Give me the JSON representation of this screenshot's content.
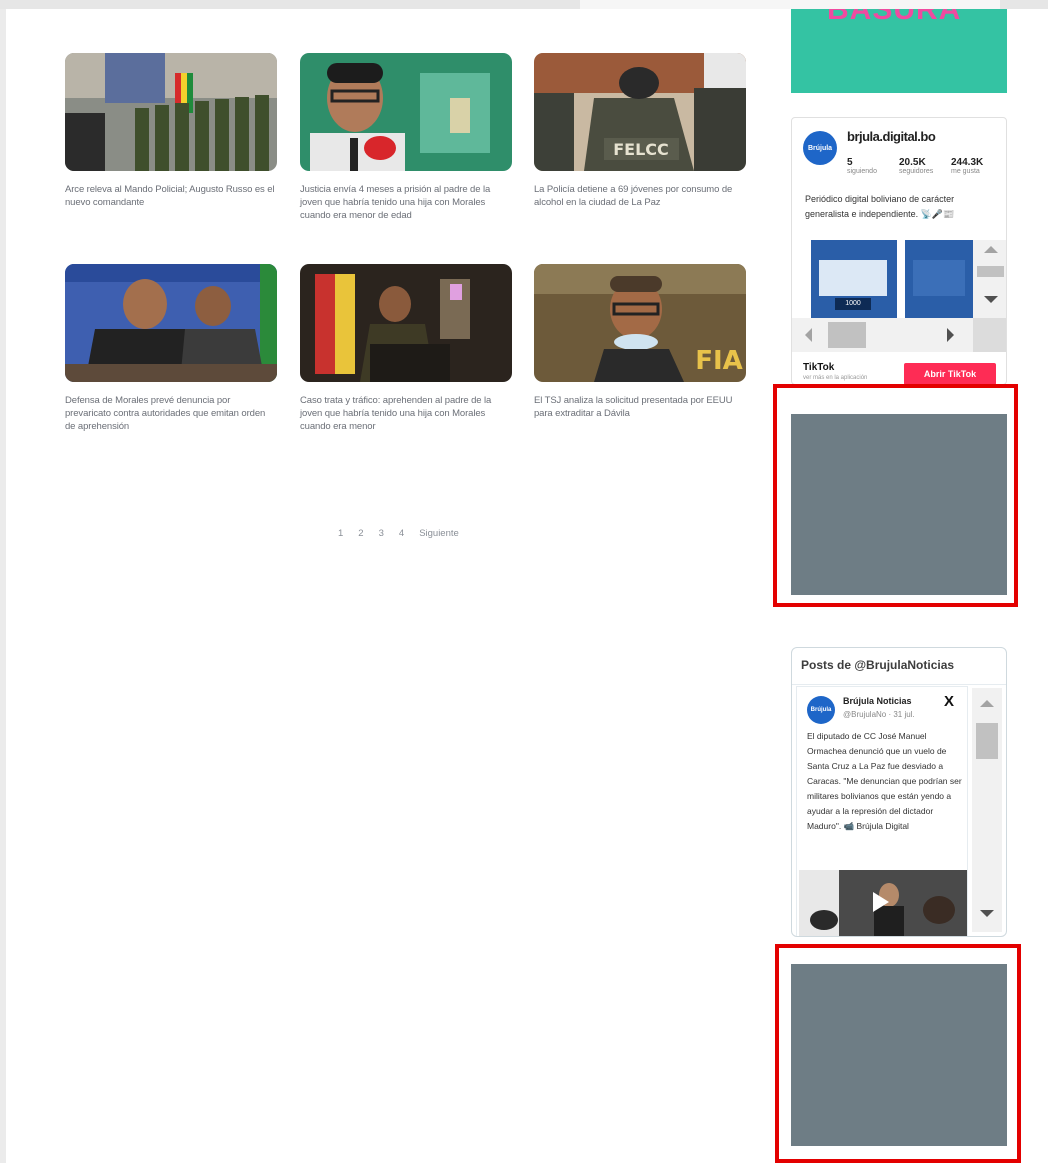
{
  "news": [
    {
      "caption": "Arce releva al Mando Policial; Augusto Russo es el nuevo comandante"
    },
    {
      "caption": "Justicia envía 4 meses a prisión al padre de la joven que habría tenido una hija con Morales cuando era menor de edad"
    },
    {
      "caption": "La Policía detiene a 69 jóvenes por consumo de alcohol en la ciudad de La Paz"
    },
    {
      "caption": "Defensa de Morales prevé denuncia por prevaricato contra autoridades que emitan orden de aprehensión"
    },
    {
      "caption": "Caso trata y tráfico: aprehenden al padre de la joven que habría tenido una hija con Morales cuando era menor"
    },
    {
      "caption": "El TSJ analiza la solicitud presentada por EEUU para extraditar a Dávila"
    }
  ],
  "thumb_text": {
    "felcc": "FELCC",
    "fia": "FIA"
  },
  "pagination": {
    "pages": [
      "1",
      "2",
      "3",
      "4"
    ],
    "next": "Siguiente"
  },
  "ad_top": {
    "word": "BASURA"
  },
  "tiktok": {
    "logo_text": "Brújula",
    "handle": "brjula.digital.bo",
    "stats": [
      {
        "value": "5",
        "label": "siguiendo"
      },
      {
        "value": "20.5K",
        "label": "seguidores"
      },
      {
        "value": "244.3K",
        "label": "me gusta"
      }
    ],
    "bio": "Periódico digital boliviano de carácter generalista e independiente. 📡🎤📰",
    "video_tag": "1000",
    "brand": "TikTok",
    "sub": "ver más en la aplicación",
    "open_button": "Abrir TikTok"
  },
  "twitter": {
    "header": "Posts de @BrujulaNoticias",
    "avatar_text": "Brújula",
    "name": "Brújula Noticias",
    "meta": "@BrujulaNo · 31 jul.",
    "x_logo": "X",
    "text": "El diputado de CC José Manuel Ormachea denunció que un vuelo de Santa Cruz a La Paz fue desviado a Caracas. \"Me denuncian que podrían ser militares bolivianos que están yendo a ayudar a la represión del dictador Maduro\". 📹 Brújula Digital"
  },
  "colors": {
    "accent_red": "#e30000",
    "ad_gray": "#6e7d85",
    "ad_teal": "#34c3a3",
    "tiktok_red": "#fe2c55",
    "brand_blue": "#1e66c8"
  }
}
